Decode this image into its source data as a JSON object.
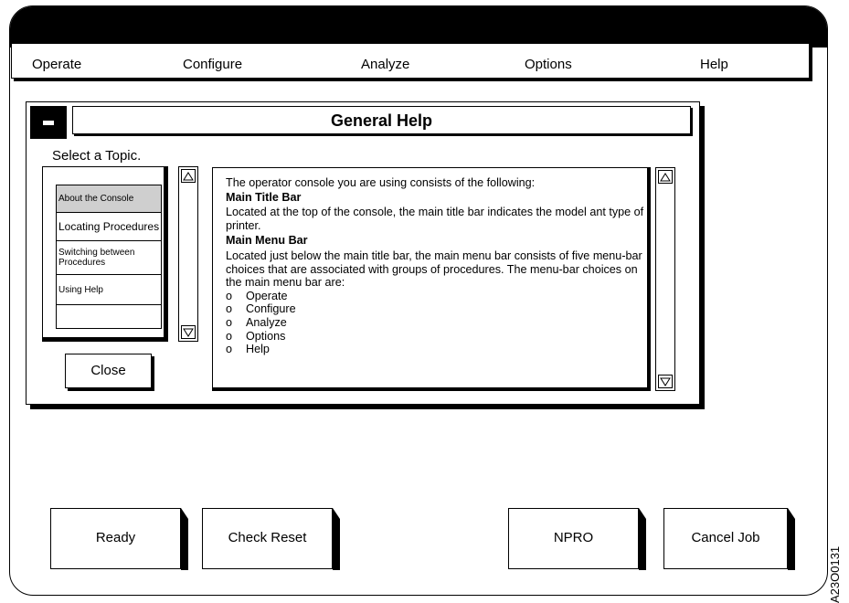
{
  "menu": {
    "items": [
      "Operate",
      "Configure",
      "Analyze",
      "Options",
      "Help"
    ]
  },
  "dialog": {
    "title": "General Help",
    "select_label": "Select a Topic.",
    "topics": [
      "About the Console",
      "Locating Procedures",
      "Switching between Procedures",
      "Using Help",
      ""
    ],
    "selected_topic": "About the Console",
    "close_label": "Close",
    "content": {
      "intro": "The operator console you are using consists of the following:",
      "heading1": "Main Title Bar",
      "para1": "Located at the top of the console, the main title bar indicates the model ant type of printer.",
      "heading2": "Main Menu Bar",
      "para2": "Located just below the main title bar, the main menu bar consists of five menu-bar choices that are associated with groups of procedures. The menu-bar choices on the main menu bar are:",
      "bullet_marker": "o",
      "bullets": [
        "Operate",
        "Configure",
        "Analyze",
        "Options",
        "Help"
      ]
    }
  },
  "buttons": {
    "ready": "Ready",
    "check_reset": "Check Reset",
    "npro": "NPRO",
    "cancel_job": "Cancel Job"
  },
  "figure_id": "A23O0131"
}
